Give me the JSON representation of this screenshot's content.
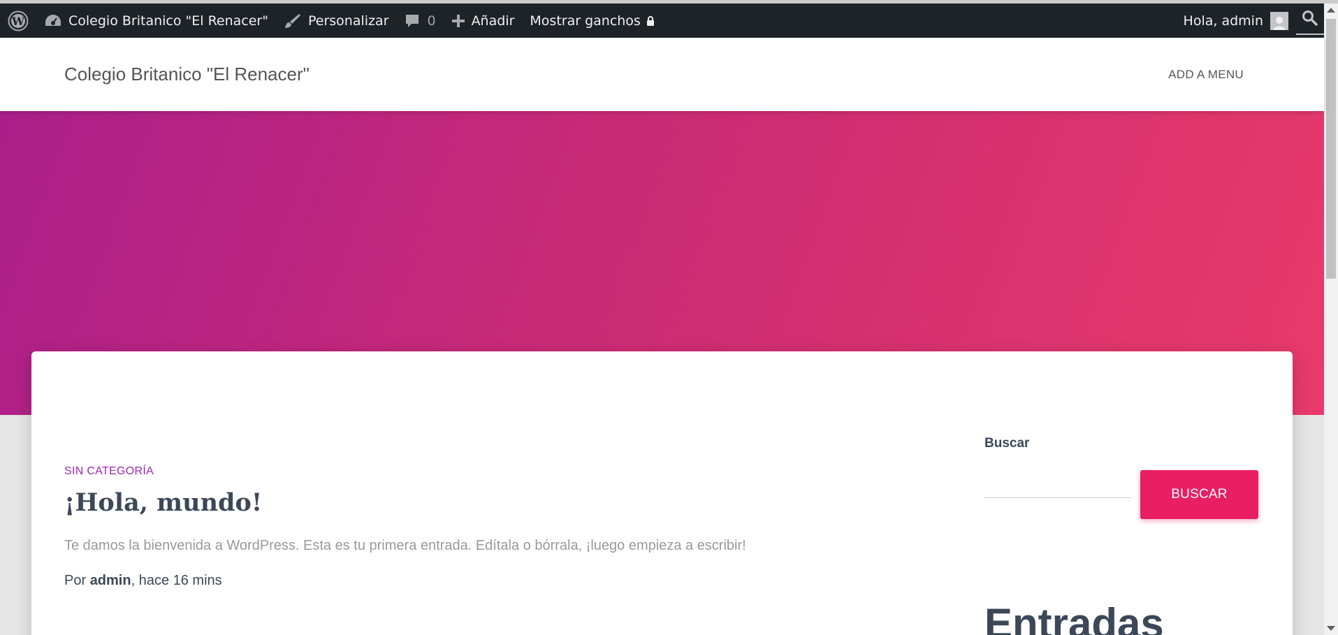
{
  "adminbar": {
    "site_name": "Colegio Britanico \"El Renacer\"",
    "customize": "Personalizar",
    "comments_count": "0",
    "add_new": "Añadir",
    "show_hooks": "Mostrar ganchos",
    "greeting": "Hola, admin"
  },
  "header": {
    "site_title": "Colegio Britanico \"El Renacer\"",
    "menu_link": "ADD A MENU"
  },
  "post": {
    "category": "SIN CATEGORÍA",
    "title": "¡Hola, mundo!",
    "excerpt": "Te damos la bienvenida a WordPress. Esta es tu primera entrada. Edítala o bórrala, ¡luego empieza a escribir!",
    "by_prefix": "Por ",
    "author": "admin",
    "time_suffix": ", hace 16 mins"
  },
  "sidebar": {
    "search_label": "Buscar",
    "search_value": "",
    "search_button": "BUSCAR",
    "entries_heading": "Entradas"
  },
  "colors": {
    "adminbar_bg": "#1d2327",
    "accent": "#e91e63",
    "category": "#9c27b0",
    "hero_start": "#ab1f8b",
    "hero_end": "#e83a6c"
  }
}
